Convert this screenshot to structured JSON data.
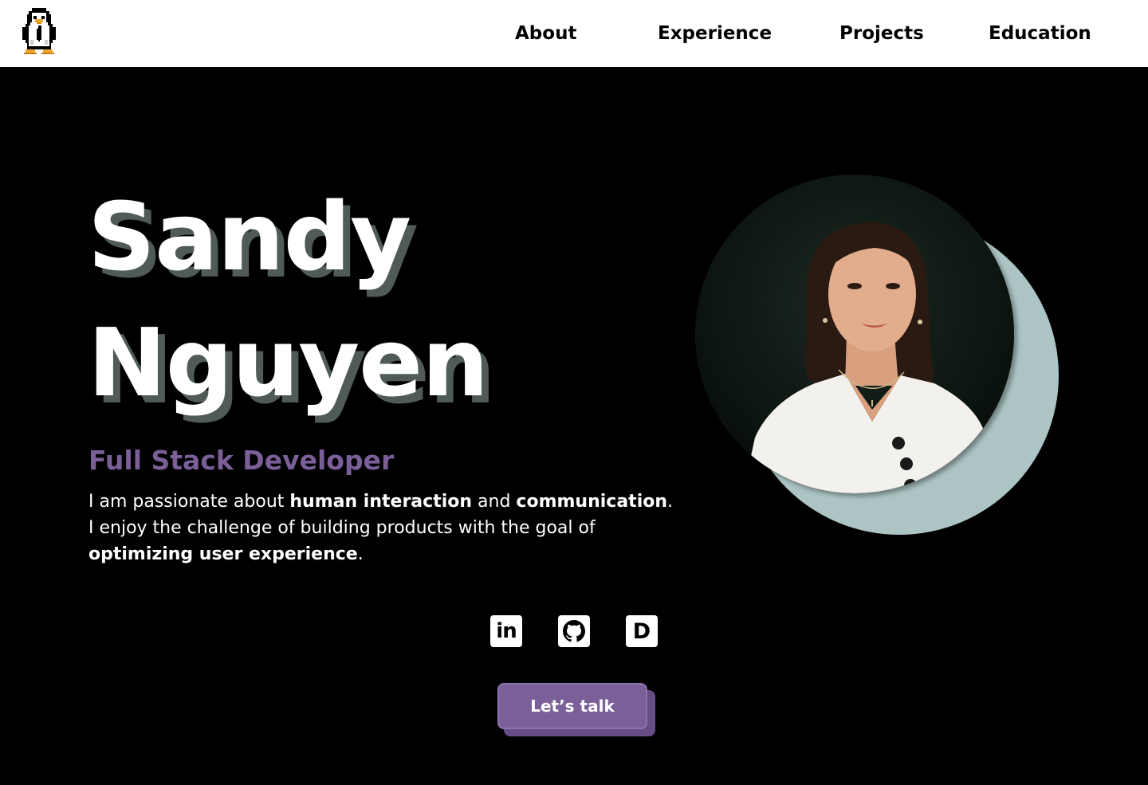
{
  "nav": {
    "logo_icon": "pixel-penguin-icon",
    "links": [
      {
        "label": "About"
      },
      {
        "label": "Experience"
      },
      {
        "label": "Projects"
      },
      {
        "label": "Education"
      }
    ]
  },
  "hero": {
    "first_name": "Sandy",
    "last_name": "Nguyen",
    "role": "Full Stack Developer",
    "bio": {
      "line1_a": "I am passionate about ",
      "line1_b": "human interaction",
      "line1_c": " and ",
      "line1_d": "communication",
      "line1_e": ".",
      "line2": "I enjoy the challenge of building products with the goal of",
      "line3_a": "optimizing user experience",
      "line3_b": "."
    },
    "portrait_icon": "profile-photo"
  },
  "social": [
    {
      "name": "linkedin-icon",
      "glyph": "in"
    },
    {
      "name": "github-icon",
      "glyph": ""
    },
    {
      "name": "devto-icon",
      "glyph": "D"
    }
  ],
  "cta": {
    "label": "Let’s talk"
  },
  "colors": {
    "background": "#000000",
    "nav_background": "#ffffff",
    "accent_purple": "#7a5f99",
    "portrait_backdrop": "#acc5c4",
    "name_shadow": "#4f5a59"
  }
}
